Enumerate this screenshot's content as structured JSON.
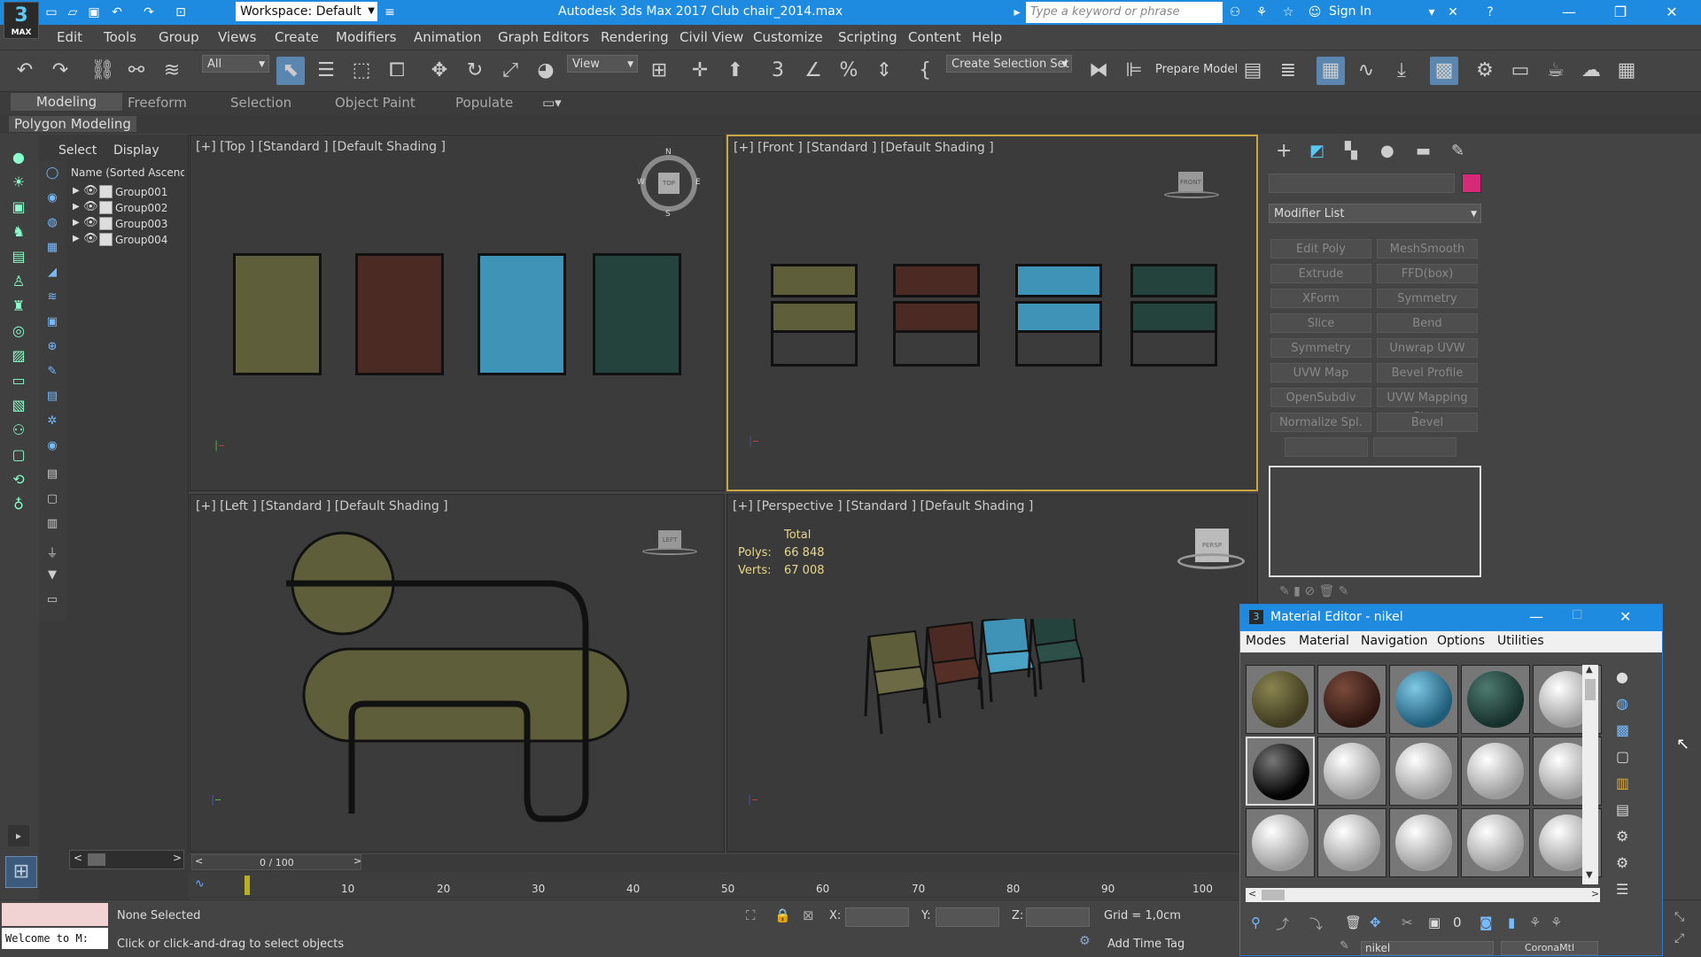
{
  "titlebar": {
    "logo": "3",
    "logo_sub": "MAX",
    "title": "Autodesk 3ds Max 2017    Club chair_2014.max",
    "workspace": "Workspace: Default",
    "search_placeholder": "Type a keyword or phrase",
    "signin": "Sign In"
  },
  "menu": [
    "Edit",
    "Tools",
    "Group",
    "Views",
    "Create",
    "Modifiers",
    "Animation",
    "Graph Editors",
    "Rendering",
    "Civil View",
    "Customize",
    "Scripting",
    "Content",
    "Help"
  ],
  "toolbar": {
    "filter": "All",
    "refcoord": "View",
    "selection_set": "Create Selection Set",
    "prepare_model": "Prepare Model"
  },
  "ribbon": {
    "tabs": [
      "Modeling",
      "Freeform",
      "Selection",
      "Object Paint",
      "Populate"
    ],
    "active": "Modeling",
    "panel": "Polygon Modeling"
  },
  "explorer": {
    "tabs": [
      "Select",
      "Display"
    ],
    "header": "Name (Sorted Ascendi",
    "items": [
      "Group001",
      "Group002",
      "Group003",
      "Group004"
    ]
  },
  "viewports": {
    "top": "[+] [Top ] [Standard ] [Default Shading ]",
    "front": "[+] [Front ] [Standard ] [Default Shading ]",
    "left": "[+] [Left ] [Standard ] [Default Shading ]",
    "perspective": "[+] [Perspective ] [Standard ] [Default Shading ]",
    "stats": {
      "total": "Total",
      "polys_label": "Polys:",
      "polys": "66 848",
      "verts_label": "Verts:",
      "verts": "67 008"
    },
    "viewcube": {
      "top": "TOP",
      "front": "FRONT",
      "left": "LEFT",
      "persp": "PERSP",
      "n": "N",
      "s": "S",
      "w": "W",
      "e": "E"
    }
  },
  "colors": {
    "olive": "#5f5e3b",
    "brown": "#4a2a22",
    "blue": "#3f93b6",
    "green": "#24433d",
    "accent": "#1e8be0",
    "swatch": "#d62a79"
  },
  "command_panel": {
    "modifier_list": "Modifier List",
    "buttons": [
      "Edit Poly",
      "MeshSmooth",
      "Extrude",
      "FFD(box)",
      "XForm",
      "Symmetry",
      "Slice",
      "Bend",
      "Symmetry",
      "Unwrap UVW",
      "UVW Map",
      "Bevel Profile",
      "OpenSubdiv",
      "UVW Mapping Clear",
      "Normalize Spl.",
      "Bevel"
    ]
  },
  "material_editor": {
    "title": "Material Editor - nikel",
    "menu": [
      "Modes",
      "Material",
      "Navigation",
      "Options",
      "Utilities"
    ],
    "material_name": "nikel",
    "material_type": "CoronaMtl"
  },
  "timeline": {
    "frame": "0 / 100",
    "ticks": [
      "10",
      "20",
      "30",
      "40",
      "50",
      "60",
      "70",
      "80",
      "90",
      "100"
    ]
  },
  "status": {
    "welcome": "Welcome to M:",
    "selection": "None Selected",
    "prompt": "Click or click-and-drag to select objects",
    "x_label": "X:",
    "y_label": "Y:",
    "z_label": "Z:",
    "grid": "Grid = 1,0cm",
    "add_time_tag": "Add Time Tag"
  }
}
